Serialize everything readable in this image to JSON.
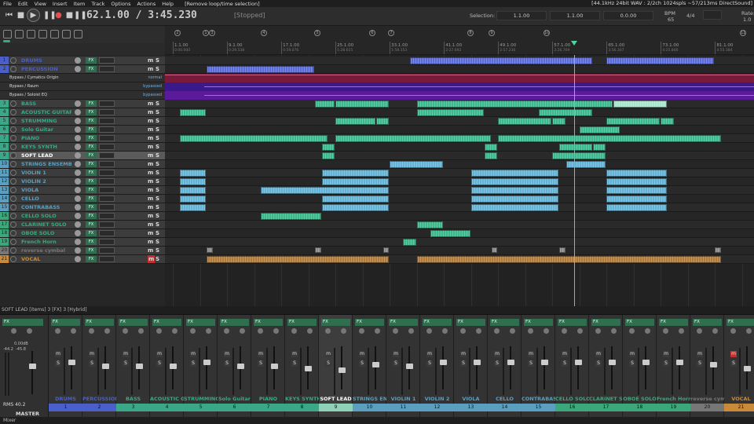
{
  "menu": {
    "items": [
      "File",
      "Edit",
      "View",
      "Insert",
      "Item",
      "Track",
      "Options",
      "Actions",
      "Help"
    ],
    "status": "[Remove loop/time selection]",
    "right_info": "[44.1kHz 24bit WAV : 2/2ch 1024spls ~57/213ms DirectSound]"
  },
  "transport": {
    "time": "62.1.00 / 3:45.230",
    "state": "[Stopped]",
    "selection_label": "Selection:",
    "sel_start": "1.1.00",
    "sel_end": "1.1.00",
    "sel_len": "0.0.00",
    "bpm_label": "BPM",
    "bpm": "65",
    "timesig": "4/4",
    "rate_label": "Rate:",
    "rate": "1.0"
  },
  "ruler": {
    "bars": [
      "1.1.00",
      "9.1.00",
      "17.1.00",
      "25.1.00",
      "33.1.00",
      "41.1.00",
      "49.1.00",
      "57.1.00",
      "65.1.00",
      "73.1.00",
      "81.1.00"
    ],
    "times": [
      "0:00.000",
      "0:29.538",
      "0:59.076",
      "1:28.615",
      "1:58.153",
      "2:27.692",
      "2:57.230",
      "3:26.769",
      "3:56.307",
      "4:25.846",
      "4:55.384"
    ],
    "markers": [
      "2",
      "1",
      "3",
      "4",
      "5",
      "6",
      "7",
      "8",
      "9",
      "10",
      "11"
    ]
  },
  "fx_rows": [
    {
      "name": "Bypass / Cymatics Origin",
      "mode": "normal"
    },
    {
      "name": "Bypass / Raum",
      "mode": "bypassed"
    },
    {
      "name": "Bypass / Soloist EQ",
      "mode": "bypassed"
    }
  ],
  "fx_label": "FX",
  "m_label": "m",
  "s_label": "S",
  "tracks": [
    {
      "num": "1",
      "name": "DRUMS",
      "color": "#4a5fc9"
    },
    {
      "num": "2",
      "name": "PERCUSSION",
      "color": "#4a5fc9"
    },
    {
      "num": "3",
      "name": "BASS",
      "color": "#3aa888"
    },
    {
      "num": "4",
      "name": "ACOUSTIC GUITAR LEAD",
      "color": "#3aa888"
    },
    {
      "num": "5",
      "name": "STRUMMING",
      "color": "#3aa888"
    },
    {
      "num": "6",
      "name": "Solo Guitar",
      "color": "#3aa888"
    },
    {
      "num": "7",
      "name": "PIANO",
      "color": "#3aa888"
    },
    {
      "num": "8",
      "name": "KEYS SYNTH",
      "color": "#3aa888"
    },
    {
      "num": "9",
      "name": "SOFT LEAD",
      "color": "#3aa888"
    },
    {
      "num": "10",
      "name": "STRINGS ENSEMBLE",
      "color": "#5a9fc0"
    },
    {
      "num": "11",
      "name": "VIOLIN 1",
      "color": "#5a9fc0"
    },
    {
      "num": "12",
      "name": "VIOLIN 2",
      "color": "#5a9fc0"
    },
    {
      "num": "13",
      "name": "VIOLA",
      "color": "#5a9fc0"
    },
    {
      "num": "14",
      "name": "CELLO",
      "color": "#5a9fc0"
    },
    {
      "num": "15",
      "name": "CONTRABASS",
      "color": "#5a9fc0"
    },
    {
      "num": "16",
      "name": "CELLO SOLO",
      "color": "#3aa87a"
    },
    {
      "num": "17",
      "name": "CLARINET SOLO",
      "color": "#3aa87a"
    },
    {
      "num": "18",
      "name": "OBOE SOLO",
      "color": "#3aa87a"
    },
    {
      "num": "19",
      "name": "French Horn",
      "color": "#3aa87a"
    },
    {
      "num": "20",
      "name": "reverse cymbal",
      "color": "#777777"
    },
    {
      "num": "21",
      "name": "VOCAL",
      "color": "#c98a3a"
    }
  ],
  "status_line": "SOFT LEAD [items] 3 [FX] 3 [Hybrid]",
  "mixer": {
    "master_label": "MASTER",
    "rms_label": "RMS",
    "rms_value": "40.2",
    "master_peak_left": "-44.2",
    "master_peak_right": "-45.8",
    "master_gain": "0.00dB",
    "tab_label": "Mixer",
    "strips": [
      {
        "name": "DRUMS",
        "num": "1",
        "color": "#4a5fc9"
      },
      {
        "name": "PERCUSSION",
        "num": "2",
        "color": "#4a5fc9"
      },
      {
        "name": "BASS",
        "num": "3",
        "color": "#3aa888"
      },
      {
        "name": "ACOUSTIC GUI",
        "num": "4",
        "color": "#3aa888"
      },
      {
        "name": "STRUMMING",
        "num": "5",
        "color": "#3aa888"
      },
      {
        "name": "Solo Guitar",
        "num": "6",
        "color": "#3aa888"
      },
      {
        "name": "PIANO",
        "num": "7",
        "color": "#3aa888"
      },
      {
        "name": "KEYS SYNTH",
        "num": "8",
        "color": "#3aa888"
      },
      {
        "name": "SOFT LEAD",
        "num": "9",
        "color": "#8fd0b8"
      },
      {
        "name": "STRINGS ENS",
        "num": "10",
        "color": "#5a9fc0"
      },
      {
        "name": "VIOLIN 1",
        "num": "11",
        "color": "#5a9fc0"
      },
      {
        "name": "VIOLIN 2",
        "num": "12",
        "color": "#5a9fc0"
      },
      {
        "name": "VIOLA",
        "num": "13",
        "color": "#5a9fc0"
      },
      {
        "name": "CELLO",
        "num": "14",
        "color": "#5a9fc0"
      },
      {
        "name": "CONTRABASS",
        "num": "15",
        "color": "#5a9fc0"
      },
      {
        "name": "CELLO SOLO",
        "num": "16",
        "color": "#3aa87a"
      },
      {
        "name": "CLARINET SOL",
        "num": "17",
        "color": "#3aa87a"
      },
      {
        "name": "OBOE SOLO",
        "num": "18",
        "color": "#3aa87a"
      },
      {
        "name": "French Horn",
        "num": "19",
        "color": "#3aa87a"
      },
      {
        "name": "reverse cymb",
        "num": "20",
        "color": "#777777"
      },
      {
        "name": "VOCAL",
        "num": "21",
        "color": "#c98a3a"
      }
    ]
  }
}
